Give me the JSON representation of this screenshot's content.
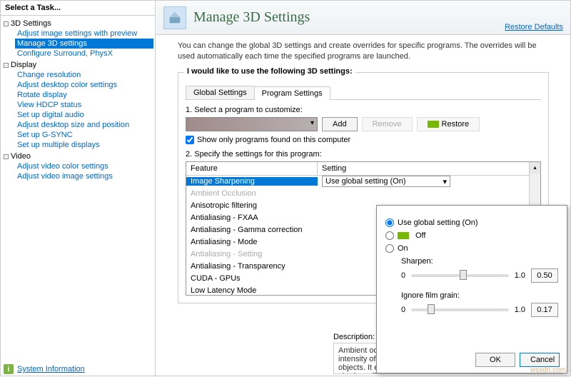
{
  "sidebar": {
    "header": "Select a Task...",
    "categories": [
      {
        "label": "3D Settings",
        "items": [
          "Adjust image settings with preview",
          "Manage 3D settings",
          "Configure Surround, PhysX"
        ],
        "selected": 1
      },
      {
        "label": "Display",
        "items": [
          "Change resolution",
          "Adjust desktop color settings",
          "Rotate display",
          "View HDCP status",
          "Set up digital audio",
          "Adjust desktop size and position",
          "Set up G-SYNC",
          "Set up multiple displays"
        ]
      },
      {
        "label": "Video",
        "items": [
          "Adjust video color settings",
          "Adjust video image settings"
        ]
      }
    ],
    "sysinfo": "System Information"
  },
  "header": {
    "title": "Manage 3D Settings",
    "restore": "Restore Defaults"
  },
  "intro": "You can change the global 3D settings and create overrides for specific programs. The overrides will be used automatically each time the specified programs are launched.",
  "group_label": "I would like to use the following 3D settings:",
  "tabs": [
    "Global Settings",
    "Program Settings"
  ],
  "step1": {
    "label": "1. Select a program to customize:",
    "add": "Add",
    "remove": "Remove",
    "restore": "Restore",
    "checkbox": "Show only programs found on this computer"
  },
  "step2": {
    "label": "2. Specify the settings for this program:",
    "col1": "Feature",
    "col2": "Setting",
    "rows": [
      {
        "feature": "Image Sharpening",
        "setting": "Use global setting (On)",
        "selected": true
      },
      {
        "feature": "Ambient Occlusion",
        "disabled": true
      },
      {
        "feature": "Anisotropic filtering"
      },
      {
        "feature": "Antialiasing - FXAA"
      },
      {
        "feature": "Antialiasing - Gamma correction"
      },
      {
        "feature": "Antialiasing - Mode"
      },
      {
        "feature": "Antialiasing - Setting",
        "disabled": true
      },
      {
        "feature": "Antialiasing - Transparency"
      },
      {
        "feature": "CUDA - GPUs"
      },
      {
        "feature": "Low Latency Mode"
      }
    ]
  },
  "description": {
    "label": "Description:",
    "text": "Ambient occlusion adds realism to scenes by reducing the intensity of ambient light on surfaces blocked by surrounding objects. It enhances depth perception by providing a soft shadow effect that makes objects appear more three-dimensional within a scene. NVIDIA's Screen Space Ambient Occlusion algorithm provides high-quality results."
  },
  "popup": {
    "opt_global": "Use global setting (On)",
    "opt_off": "Off",
    "opt_on": "On",
    "sharpen": "Sharpen:",
    "sharpen_min": "0",
    "sharpen_max": "1.0",
    "sharpen_val": "0.50",
    "grain": "Ignore film grain:",
    "grain_min": "0",
    "grain_max": "1.0",
    "grain_val": "0.17",
    "ok": "OK",
    "cancel": "Cancel"
  },
  "watermark": "wsxdn.com"
}
